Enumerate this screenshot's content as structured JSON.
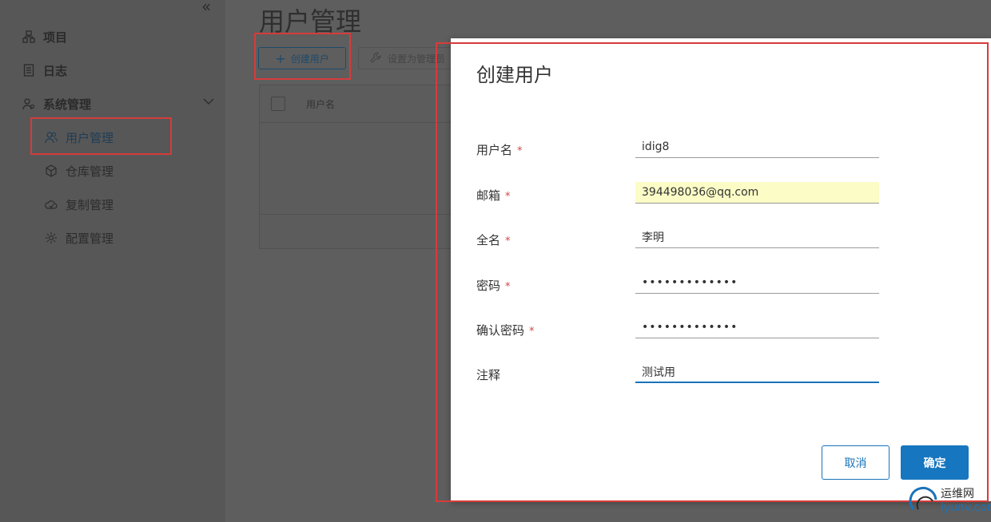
{
  "sidebar": {
    "items": [
      {
        "label": "项目",
        "icon": "project-icon"
      },
      {
        "label": "日志",
        "icon": "log-icon"
      },
      {
        "label": "系统管理",
        "icon": "system-admin-icon"
      }
    ],
    "sub_items": [
      {
        "label": "用户管理",
        "icon": "users-icon",
        "active": true
      },
      {
        "label": "仓库管理",
        "icon": "repository-icon"
      },
      {
        "label": "复制管理",
        "icon": "replication-icon"
      },
      {
        "label": "配置管理",
        "icon": "gear-icon"
      }
    ]
  },
  "main": {
    "page_title": "用户管理",
    "create_button": "创建用户",
    "admin_button": "设置为管理员",
    "table_header_username": "用户名"
  },
  "modal": {
    "title": "创建用户",
    "fields": {
      "username": {
        "label": "用户名",
        "value": "idig8",
        "required": true
      },
      "email": {
        "label": "邮箱",
        "value": "394498036@qq.com",
        "required": true
      },
      "fullname": {
        "label": "全名",
        "value": "李明",
        "required": true
      },
      "password": {
        "label": "密码",
        "value": "•••••••••••••",
        "required": true
      },
      "confirm": {
        "label": "确认密码",
        "value": "•••••••••••••",
        "required": true
      },
      "comment": {
        "label": "注释",
        "value": "测试用",
        "required": false
      }
    },
    "required_mark": "*",
    "cancel": "取消",
    "ok": "确定"
  },
  "watermark": {
    "line1": "运维网",
    "line2": "iyunv.com"
  },
  "colors": {
    "accent": "#1676bf",
    "highlight": "#d63b3b",
    "autofill": "#fbfcc6"
  }
}
